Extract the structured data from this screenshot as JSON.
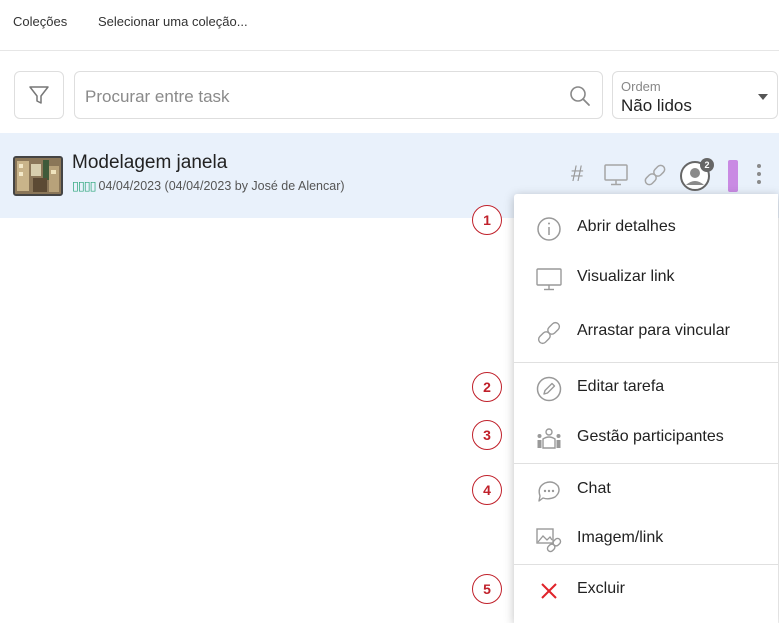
{
  "header": {
    "collections_label": "Coleções",
    "select_collection": "Selecionar uma coleção..."
  },
  "toolbar": {
    "filter_icon": "filter-icon",
    "search_placeholder": "Procurar entre task",
    "search_icon": "search-icon",
    "order_label": "Ordem",
    "order_value": "Não lidos"
  },
  "task": {
    "title": "Modelagem janela",
    "tag_glyphs": "▯▯▯▯",
    "meta": "04/04/2023 (04/04/2023 by José de Alencar)",
    "hash_symbol": "#",
    "participants_count": "2",
    "color_label": "#c98ae3"
  },
  "menu": {
    "items": [
      {
        "label": "Abrir detalhes",
        "icon": "info-icon"
      },
      {
        "label": "Visualizar link",
        "icon": "monitor-icon"
      },
      {
        "label": "Arrastar para vincular",
        "icon": "link-icon"
      },
      {
        "label": "Editar tarefa",
        "icon": "pencil-icon"
      },
      {
        "label": "Gestão participantes",
        "icon": "participants-icon"
      },
      {
        "label": "Chat",
        "icon": "chat-icon"
      },
      {
        "label": "Imagem/link",
        "icon": "image-link-icon"
      },
      {
        "label": "Excluir",
        "icon": "close-icon"
      }
    ]
  },
  "callouts": [
    "1",
    "2",
    "3",
    "4",
    "5"
  ],
  "colors": {
    "row_highlight": "#e9f1fb",
    "callout_red": "#c0202a",
    "delete_red": "#e0242a",
    "tag_green": "#2aa57a"
  }
}
